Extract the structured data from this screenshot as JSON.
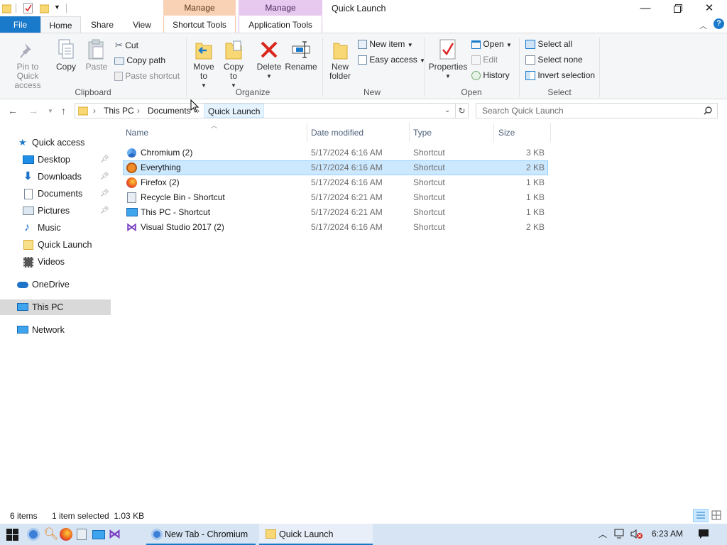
{
  "window": {
    "title": "Quick Launch",
    "context_tabs": [
      {
        "header": "Manage",
        "label": "Shortcut Tools"
      },
      {
        "header": "Manage",
        "label": "Application Tools"
      }
    ]
  },
  "tabs": [
    "File",
    "Home",
    "Share",
    "View"
  ],
  "ribbon": {
    "clipboard": {
      "pin": "Pin to Quick access",
      "copy": "Copy",
      "paste": "Paste",
      "cut": "Cut",
      "copy_path": "Copy path",
      "paste_shortcut": "Paste shortcut",
      "group": "Clipboard"
    },
    "organize": {
      "move_to": "Move to",
      "copy_to": "Copy to",
      "delete": "Delete",
      "rename": "Rename",
      "group": "Organize"
    },
    "new": {
      "new_folder": "New folder",
      "new_item": "New item",
      "easy_access": "Easy access",
      "group": "New"
    },
    "open": {
      "properties": "Properties",
      "open": "Open",
      "edit": "Edit",
      "history": "History",
      "group": "Open"
    },
    "select": {
      "select_all": "Select all",
      "select_none": "Select none",
      "invert": "Invert selection",
      "group": "Select"
    }
  },
  "address": {
    "crumbs": [
      "This PC",
      "Documents",
      "Quick Launch"
    ],
    "search_placeholder": "Search Quick Launch"
  },
  "nav": {
    "quick_access": "Quick access",
    "items": [
      "Desktop",
      "Downloads",
      "Documents",
      "Pictures",
      "Music",
      "Quick Launch",
      "Videos"
    ],
    "onedrive": "OneDrive",
    "this_pc": "This PC",
    "network": "Network"
  },
  "columns": [
    "Name",
    "Date modified",
    "Type",
    "Size"
  ],
  "files": [
    {
      "name": "Chromium (2)",
      "date": "5/17/2024 6:16 AM",
      "type": "Shortcut",
      "size": "3 KB"
    },
    {
      "name": "Everything",
      "date": "5/17/2024 6:16 AM",
      "type": "Shortcut",
      "size": "2 KB"
    },
    {
      "name": "Firefox (2)",
      "date": "5/17/2024 6:16 AM",
      "type": "Shortcut",
      "size": "1 KB"
    },
    {
      "name": "Recycle Bin - Shortcut",
      "date": "5/17/2024 6:21 AM",
      "type": "Shortcut",
      "size": "1 KB"
    },
    {
      "name": "This PC - Shortcut",
      "date": "5/17/2024 6:21 AM",
      "type": "Shortcut",
      "size": "1 KB"
    },
    {
      "name": "Visual Studio 2017 (2)",
      "date": "5/17/2024 6:16 AM",
      "type": "Shortcut",
      "size": "2 KB"
    }
  ],
  "status": {
    "count": "6 items",
    "selection": "1 item selected  1.03 KB"
  },
  "taskbar": {
    "apps": [
      "New Tab - Chromium",
      "Quick Launch"
    ],
    "time": "6:23 AM"
  },
  "colors": {
    "accent": "#1979ca",
    "selection": "#cce8ff",
    "taskbar": "#d6e4f3"
  }
}
